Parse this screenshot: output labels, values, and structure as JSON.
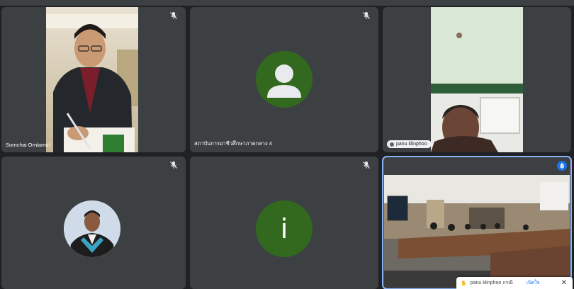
{
  "participants": [
    {
      "name": "Sornchai Ornlamul",
      "video": true,
      "muted": true
    },
    {
      "name": "สถาบันการอาชีวศึกษาภาคกลาง 4",
      "video": false,
      "avatar": "person",
      "muted": true
    },
    {
      "name": "panu klinphoo",
      "video": true,
      "muted": false
    },
    {
      "name": "",
      "video": false,
      "avatar": "photo",
      "muted": true
    },
    {
      "name": "",
      "video": false,
      "avatar": "letter",
      "initial": "i",
      "muted": true
    },
    {
      "name": "",
      "video": true,
      "muted": false,
      "speaking": true
    }
  ],
  "notification": {
    "text": "panu klinphoo กรณี",
    "action": "เปิดใจ",
    "close": "✕"
  },
  "colors": {
    "background": "#202124",
    "tile": "#3c4043",
    "avatar_green": "#33691e",
    "active_outline": "#8ab4f8",
    "speaking": "#1a73e8"
  }
}
